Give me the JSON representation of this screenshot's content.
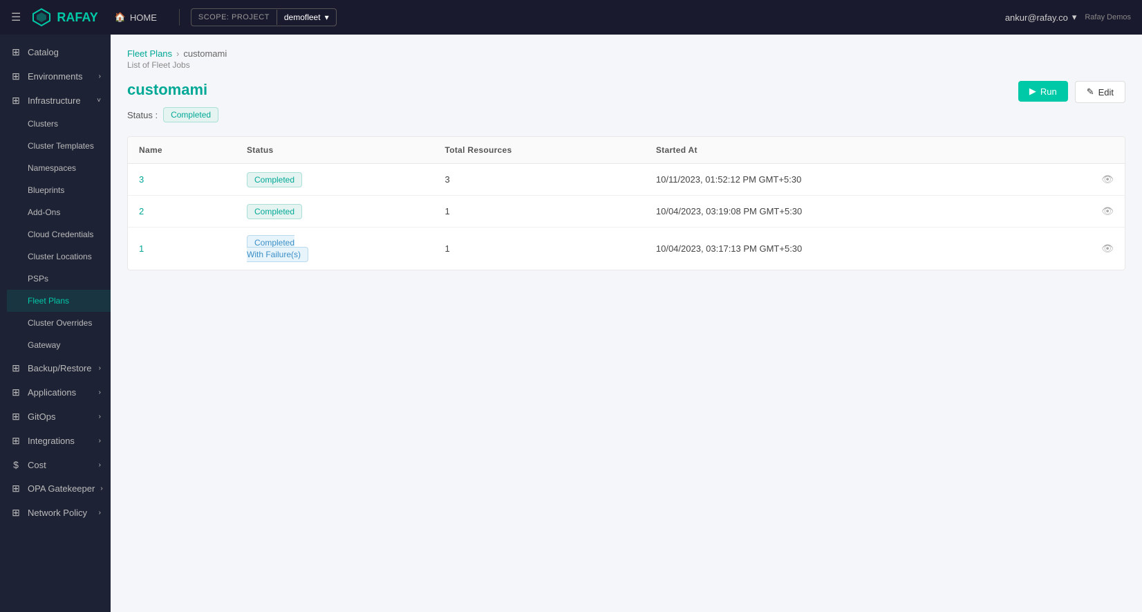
{
  "navbar": {
    "hamburger": "☰",
    "logo_text": "RAFAY",
    "home_label": "HOME",
    "scope_label": "SCOPE: PROJECT",
    "scope_value": "demofleet",
    "user_email": "ankur@rafay.co",
    "user_org": "Rafay Demos"
  },
  "sidebar": {
    "items": [
      {
        "id": "catalog",
        "label": "Catalog",
        "icon": "⊞",
        "has_chevron": false
      },
      {
        "id": "environments",
        "label": "Environments",
        "icon": "⊞",
        "has_chevron": true
      },
      {
        "id": "infrastructure",
        "label": "Infrastructure",
        "icon": "⊞",
        "has_chevron": true,
        "active": false,
        "expanded": true
      },
      {
        "id": "clusters",
        "label": "Clusters",
        "icon": "",
        "has_chevron": false,
        "sub": true
      },
      {
        "id": "cluster-templates",
        "label": "Cluster Templates",
        "icon": "",
        "has_chevron": false,
        "sub": true
      },
      {
        "id": "namespaces",
        "label": "Namespaces",
        "icon": "",
        "has_chevron": false,
        "sub": true
      },
      {
        "id": "blueprints",
        "label": "Blueprints",
        "icon": "",
        "has_chevron": false,
        "sub": true
      },
      {
        "id": "add-ons",
        "label": "Add-Ons",
        "icon": "",
        "has_chevron": false,
        "sub": true
      },
      {
        "id": "cloud-credentials",
        "label": "Cloud Credentials",
        "icon": "",
        "has_chevron": false,
        "sub": true
      },
      {
        "id": "cluster-locations",
        "label": "Cluster Locations",
        "icon": "",
        "has_chevron": false,
        "sub": true
      },
      {
        "id": "psps",
        "label": "PSPs",
        "icon": "",
        "has_chevron": false,
        "sub": true
      },
      {
        "id": "fleet-plans",
        "label": "Fleet Plans",
        "icon": "",
        "has_chevron": false,
        "sub": true,
        "active": true
      },
      {
        "id": "cluster-overrides",
        "label": "Cluster Overrides",
        "icon": "",
        "has_chevron": false,
        "sub": true
      },
      {
        "id": "gateway",
        "label": "Gateway",
        "icon": "",
        "has_chevron": false,
        "sub": true
      },
      {
        "id": "backup-restore",
        "label": "Backup/Restore",
        "icon": "⊞",
        "has_chevron": true
      },
      {
        "id": "applications",
        "label": "Applications",
        "icon": "⊞",
        "has_chevron": true
      },
      {
        "id": "gitops",
        "label": "GitOps",
        "icon": "⊞",
        "has_chevron": true
      },
      {
        "id": "integrations",
        "label": "Integrations",
        "icon": "⊞",
        "has_chevron": true
      },
      {
        "id": "cost",
        "label": "Cost",
        "icon": "$",
        "has_chevron": true
      },
      {
        "id": "opa-gatekeeper",
        "label": "OPA Gatekeeper",
        "icon": "⊞",
        "has_chevron": true
      },
      {
        "id": "network-policy",
        "label": "Network Policy",
        "icon": "⊞",
        "has_chevron": true
      }
    ]
  },
  "breadcrumb": {
    "parent": "Fleet Plans",
    "current": "customami"
  },
  "page_subtitle": "List of Fleet Jobs",
  "page_title": "customami",
  "status_label": "Status :",
  "status_badge": "Completed",
  "buttons": {
    "run": "Run",
    "edit": "Edit"
  },
  "table": {
    "columns": [
      "Name",
      "Status",
      "Total Resources",
      "Started At"
    ],
    "rows": [
      {
        "name": "3",
        "status": "Completed",
        "status_type": "completed",
        "total_resources": "3",
        "started_at": "10/11/2023, 01:52:12 PM GMT+5:30"
      },
      {
        "name": "2",
        "status": "Completed",
        "status_type": "completed",
        "total_resources": "1",
        "started_at": "10/04/2023, 03:19:08 PM GMT+5:30"
      },
      {
        "name": "1",
        "status": "Completed With Failure(s)",
        "status_type": "completed-failure",
        "total_resources": "1",
        "started_at": "10/04/2023, 03:17:13 PM GMT+5:30"
      }
    ]
  }
}
